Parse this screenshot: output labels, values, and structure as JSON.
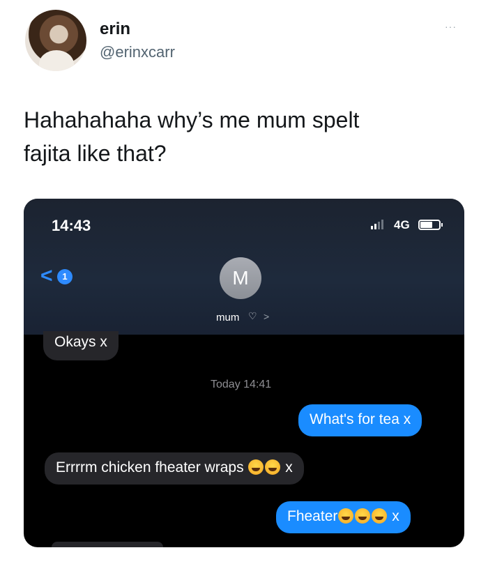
{
  "tweet": {
    "name": "erin",
    "handle": "@erinxcarr",
    "more": "···",
    "text_line1": "Hahahahaha why’s me mum spelt",
    "text_line2": "fajita like that?"
  },
  "phone": {
    "status": {
      "time": "14:43",
      "network": "4G"
    },
    "nav": {
      "back_badge": "1"
    },
    "contact": {
      "initial": "M",
      "name": "mum"
    },
    "messages": [
      {
        "direction": "incoming",
        "text": "Okays x"
      },
      {
        "direction": "incoming",
        "text": "Errrrm chicken fheater wraps",
        "suffix": "x",
        "emoji": "rolling-on-floor-laughing"
      },
      {
        "direction": "outgoing",
        "text": "What's for tea x"
      },
      {
        "direction": "outgoing",
        "text": "Fheater",
        "suffix": "x",
        "emoji": "face-with-tears-of-joy"
      }
    ],
    "timestamp": "Today 14:41"
  },
  "colors": {
    "outgoing_bubble": "#1a8cff",
    "incoming_bubble": "#26262a",
    "accent": "#2e8bff"
  }
}
